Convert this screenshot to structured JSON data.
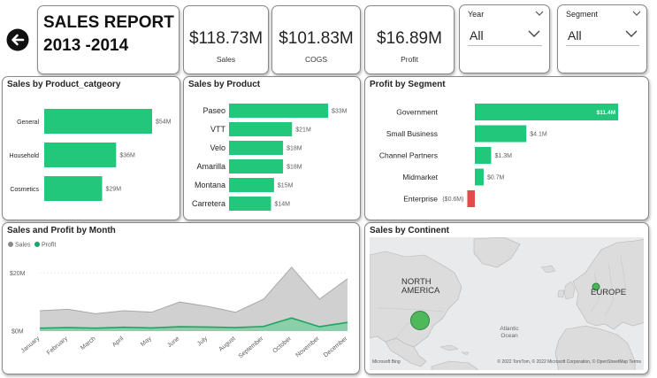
{
  "header": {
    "title_line1": "SALES REPORT |",
    "title_line2": "2013 -2014",
    "back_icon": "back-arrow-icon"
  },
  "kpis": [
    {
      "value": "$118.73M",
      "label": "Sales"
    },
    {
      "value": "$101.83M",
      "label": "COGS"
    },
    {
      "value": "$16.89M",
      "label": "Profit"
    }
  ],
  "slicers": [
    {
      "label": "Year",
      "value": "All"
    },
    {
      "label": "Segment",
      "value": "All"
    }
  ],
  "colors": {
    "bar": "#21c77a",
    "negative": "#e24b4b",
    "sales_area": "#c8c8c8",
    "profit_area": "#21a366",
    "map_bg": "#e8eaec",
    "bubble": "#47b855"
  },
  "charts": {
    "category": {
      "title": "Sales by Product_catgeory",
      "chart_data": {
        "type": "bar",
        "orientation": "horizontal",
        "categories": [
          "General",
          "Household",
          "Cosmetics"
        ],
        "values": [
          54,
          36,
          29
        ],
        "labels": [
          "$54M",
          "$36M",
          "$29M"
        ],
        "unit": "$M"
      }
    },
    "product": {
      "title": "Sales by Product",
      "chart_data": {
        "type": "bar",
        "orientation": "horizontal",
        "categories": [
          "Paseo",
          "VTT",
          "Velo",
          "Amarilla",
          "Montana",
          "Carretera"
        ],
        "values": [
          33,
          21,
          18,
          18,
          15,
          14
        ],
        "labels": [
          "$33M",
          "$21M",
          "$18M",
          "$18M",
          "$15M",
          "$14M"
        ],
        "unit": "$M"
      }
    },
    "segment": {
      "title": "Profit by Segment",
      "chart_data": {
        "type": "bar",
        "orientation": "horizontal",
        "categories": [
          "Government",
          "Small Business",
          "Channel Partners",
          "Midmarket",
          "Enterprise"
        ],
        "values": [
          11.4,
          4.1,
          1.3,
          0.7,
          -0.6
        ],
        "labels": [
          "$11.4M",
          "$4.1M",
          "$1.3M",
          "$0.7M",
          "($0.6M)"
        ],
        "unit": "$M"
      }
    },
    "monthly": {
      "title": "Sales and Profit by Month",
      "chart_data": {
        "type": "area",
        "x": [
          "January",
          "February",
          "March",
          "April",
          "May",
          "June",
          "July",
          "August",
          "September",
          "October",
          "November",
          "December"
        ],
        "series": [
          {
            "name": "Sales",
            "values": [
              7,
              7.5,
              6,
              7,
              6.5,
              10,
              8.5,
              6.5,
              11,
              22,
              11,
              18
            ]
          },
          {
            "name": "Profit",
            "values": [
              1,
              1.2,
              1,
              1.3,
              1.1,
              1.5,
              1.4,
              1.2,
              1.6,
              4.5,
              1.5,
              3
            ]
          }
        ],
        "yticks": [
          "$20M",
          "$0M"
        ],
        "ylim": [
          0,
          25
        ],
        "legend": "top-left"
      }
    },
    "continent": {
      "title": "Sales by Continent",
      "labels": {
        "north_america": "NORTH AMERICA",
        "europe": "EUROPE",
        "ocean": "Atlantic Ocean"
      },
      "attribution": "© 2022 TomTom, © 2022 Microsoft Corporation, © OpenStreetMap  Terms",
      "provider": "Microsoft Bing"
    }
  }
}
